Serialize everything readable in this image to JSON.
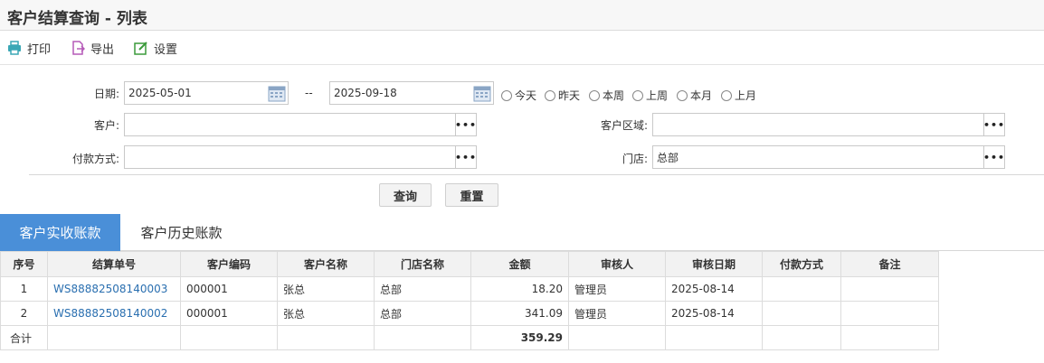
{
  "window": {
    "title": "客户结算查询 - 列表"
  },
  "toolbar": {
    "print_label": "打印",
    "export_label": "导出",
    "settings_label": "设置"
  },
  "filters": {
    "date_label": "日期:",
    "date_from": "2025-05-01",
    "date_sep": "--",
    "date_to": "2025-09-18",
    "quick_ranges": [
      "今天",
      "昨天",
      "本周",
      "上周",
      "本月",
      "上月"
    ],
    "customer_label": "客户:",
    "customer_value": "",
    "region_label": "客户区域:",
    "region_value": "",
    "payment_label": "付款方式:",
    "payment_value": "",
    "store_label": "门店:",
    "store_value": "总部",
    "ellipsis": "•••"
  },
  "actions": {
    "query_label": "查询",
    "reset_label": "重置"
  },
  "tabs": [
    {
      "label": "客户实收账款",
      "active": true
    },
    {
      "label": "客户历史账款",
      "active": false
    }
  ],
  "table": {
    "headers": [
      "序号",
      "结算单号",
      "客户编码",
      "客户名称",
      "门店名称",
      "金额",
      "审核人",
      "审核日期",
      "付款方式",
      "备注"
    ],
    "rows": [
      {
        "no": "1",
        "bill": "WS88882508140003",
        "cust_code": "000001",
        "cust_name": "张总",
        "store": "总部",
        "amount": "18.20",
        "auditor": "管理员",
        "audit_date": "2025-08-14",
        "payment": "",
        "remark": ""
      },
      {
        "no": "2",
        "bill": "WS88882508140002",
        "cust_code": "000001",
        "cust_name": "张总",
        "store": "总部",
        "amount": "341.09",
        "auditor": "管理员",
        "audit_date": "2025-08-14",
        "payment": "",
        "remark": ""
      }
    ],
    "summary": {
      "label": "合计",
      "amount": "359.29"
    }
  },
  "colors": {
    "accent": "#4a8fd8",
    "link": "#2a6fb0",
    "print_icon": "#3aa7b5",
    "export_icon": "#b55ab8",
    "settings_icon": "#3a9a3a"
  }
}
